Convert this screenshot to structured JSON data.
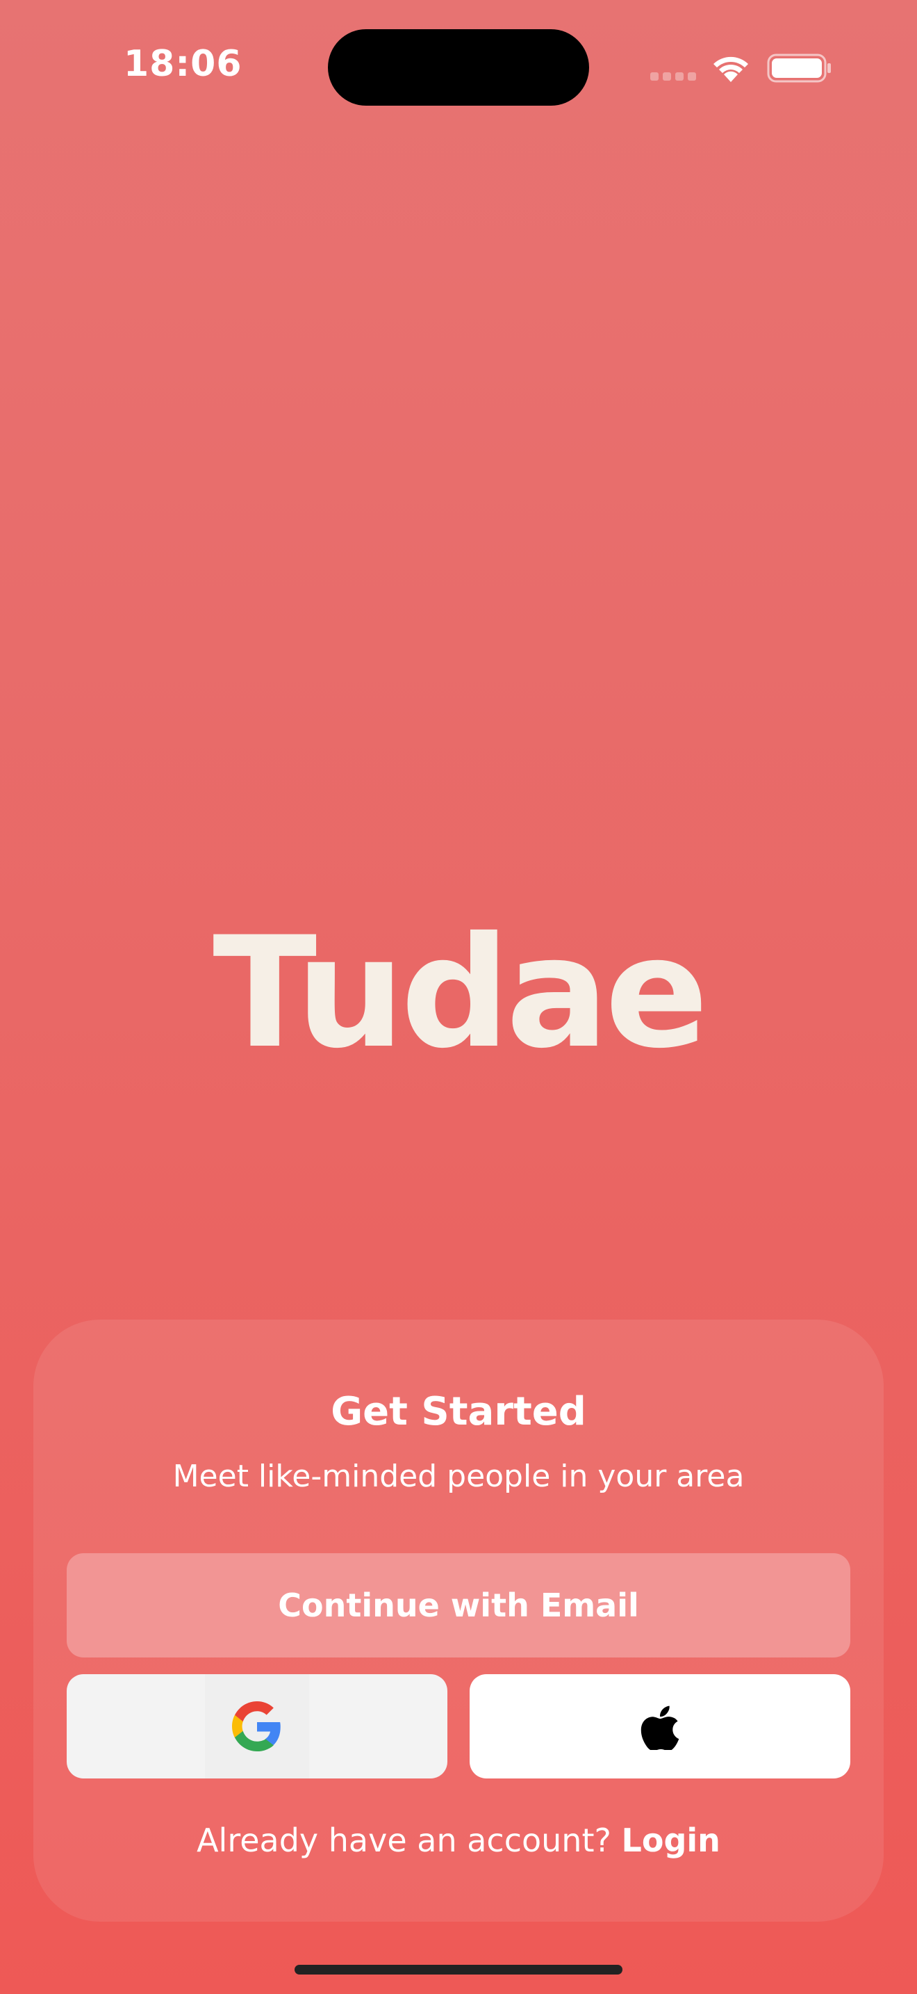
{
  "status_bar": {
    "time": "18:06"
  },
  "brand": {
    "logo_text": "Tudae"
  },
  "card": {
    "title": "Get Started",
    "subtitle": "Meet like-minded people in your area",
    "email_button_label": "Continue with Email",
    "google_icon": "google-icon",
    "apple_icon": "apple-icon",
    "login_prompt": "Already have an account? ",
    "login_link": "Login"
  },
  "colors": {
    "background_top": "#e77372",
    "background_bottom": "#ee5956",
    "logo": "#f6efe6",
    "email_button": "#f29594",
    "text": "#ffffff"
  }
}
